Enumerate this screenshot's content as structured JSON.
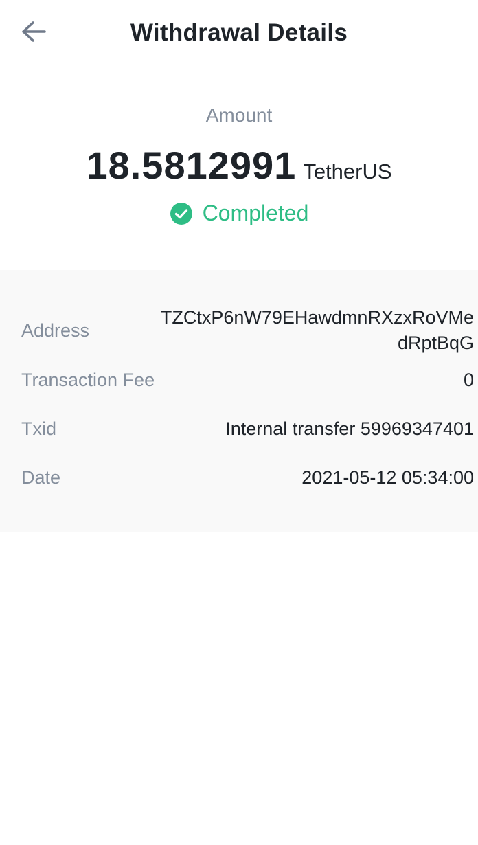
{
  "header": {
    "title": "Withdrawal Details",
    "back_icon": "arrow-left-icon"
  },
  "summary": {
    "amount_label": "Amount",
    "amount_value": "18.5812991",
    "amount_unit": "TetherUS",
    "status_icon": "check-circle-icon",
    "status_text": "Completed",
    "status_color": "#2ebd85"
  },
  "details": {
    "address": {
      "label": "Address",
      "value": "TZCtxP6nW79EHawdmnRXzxRoVMedRptBqG"
    },
    "fee": {
      "label": "Transaction Fee",
      "value": "0"
    },
    "txid": {
      "label": "Txid",
      "value": "Internal transfer 59969347401"
    },
    "date": {
      "label": "Date",
      "value": "2021-05-12 05:34:00"
    }
  },
  "colors": {
    "text_primary": "#1e2329",
    "text_secondary": "#848e9c",
    "details_background": "#f9f9f9"
  }
}
